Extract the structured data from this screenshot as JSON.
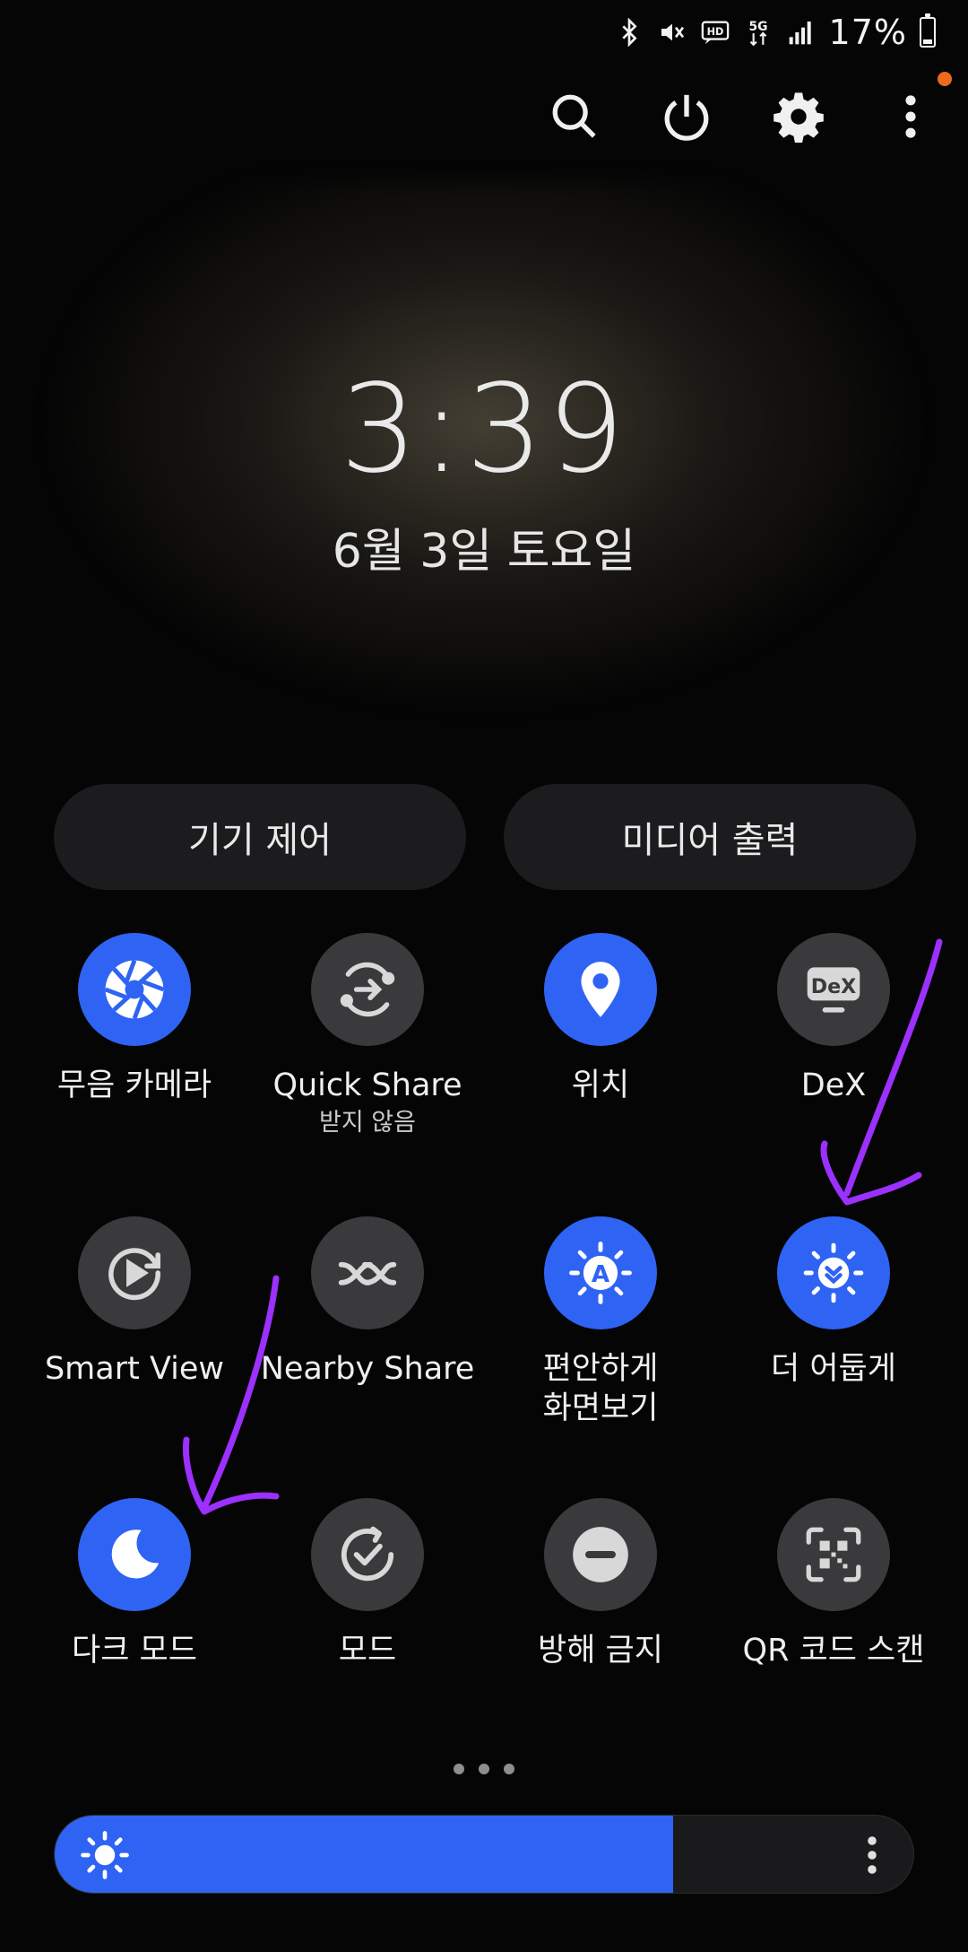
{
  "status_bar": {
    "icons": [
      "bluetooth-icon",
      "mute-icon",
      "hd-voice-icon",
      "5g-icon",
      "signal-icon"
    ],
    "hd_text": "HD",
    "net_text": "5G",
    "battery_percent": "17%",
    "battery_level": 0.17
  },
  "top_actions": {
    "icons": [
      "search-icon",
      "power-icon",
      "settings-icon",
      "more-vert-icon"
    ],
    "notification_dot_color": "#f06a1e"
  },
  "clock": {
    "time": "3:39",
    "date": "6월 3일 토요일"
  },
  "pills": {
    "device_control": "기기 제어",
    "media_output": "미디어 출력"
  },
  "tiles": [
    {
      "label": "무음 카메라",
      "sub": "",
      "state": "on",
      "icon": "camera-shutter-icon"
    },
    {
      "label": "Quick Share",
      "sub": "받지 않음",
      "state": "off",
      "icon": "quick-share-icon"
    },
    {
      "label": "위치",
      "sub": "",
      "state": "on",
      "icon": "location-pin-icon"
    },
    {
      "label": "DeX",
      "sub": "",
      "state": "off",
      "icon": "dex-icon",
      "icon_text": "DeX"
    },
    {
      "label": "Smart View",
      "sub": "",
      "state": "off",
      "icon": "smart-view-icon"
    },
    {
      "label": "Nearby Share",
      "sub": "",
      "state": "off",
      "icon": "nearby-share-icon"
    },
    {
      "label": "편안하게\n화면보기",
      "sub": "",
      "state": "on",
      "icon": "eye-comfort-icon",
      "icon_text": "A"
    },
    {
      "label": "더 어둡게",
      "sub": "",
      "state": "on",
      "icon": "extra-dim-icon"
    },
    {
      "label": "다크 모드",
      "sub": "",
      "state": "on",
      "icon": "moon-icon"
    },
    {
      "label": "모드",
      "sub": "",
      "state": "off",
      "icon": "modes-icon"
    },
    {
      "label": "방해 금지",
      "sub": "",
      "state": "off",
      "icon": "do-not-disturb-icon"
    },
    {
      "label": "QR 코드 스캔",
      "sub": "",
      "state": "off",
      "icon": "qr-scan-icon"
    }
  ],
  "pagination": {
    "pages": 3
  },
  "brightness": {
    "level": 0.72
  },
  "colors": {
    "accent": "#2f63f3",
    "tile_off": "#3a3a3c",
    "annotation": "#9b30ff"
  }
}
